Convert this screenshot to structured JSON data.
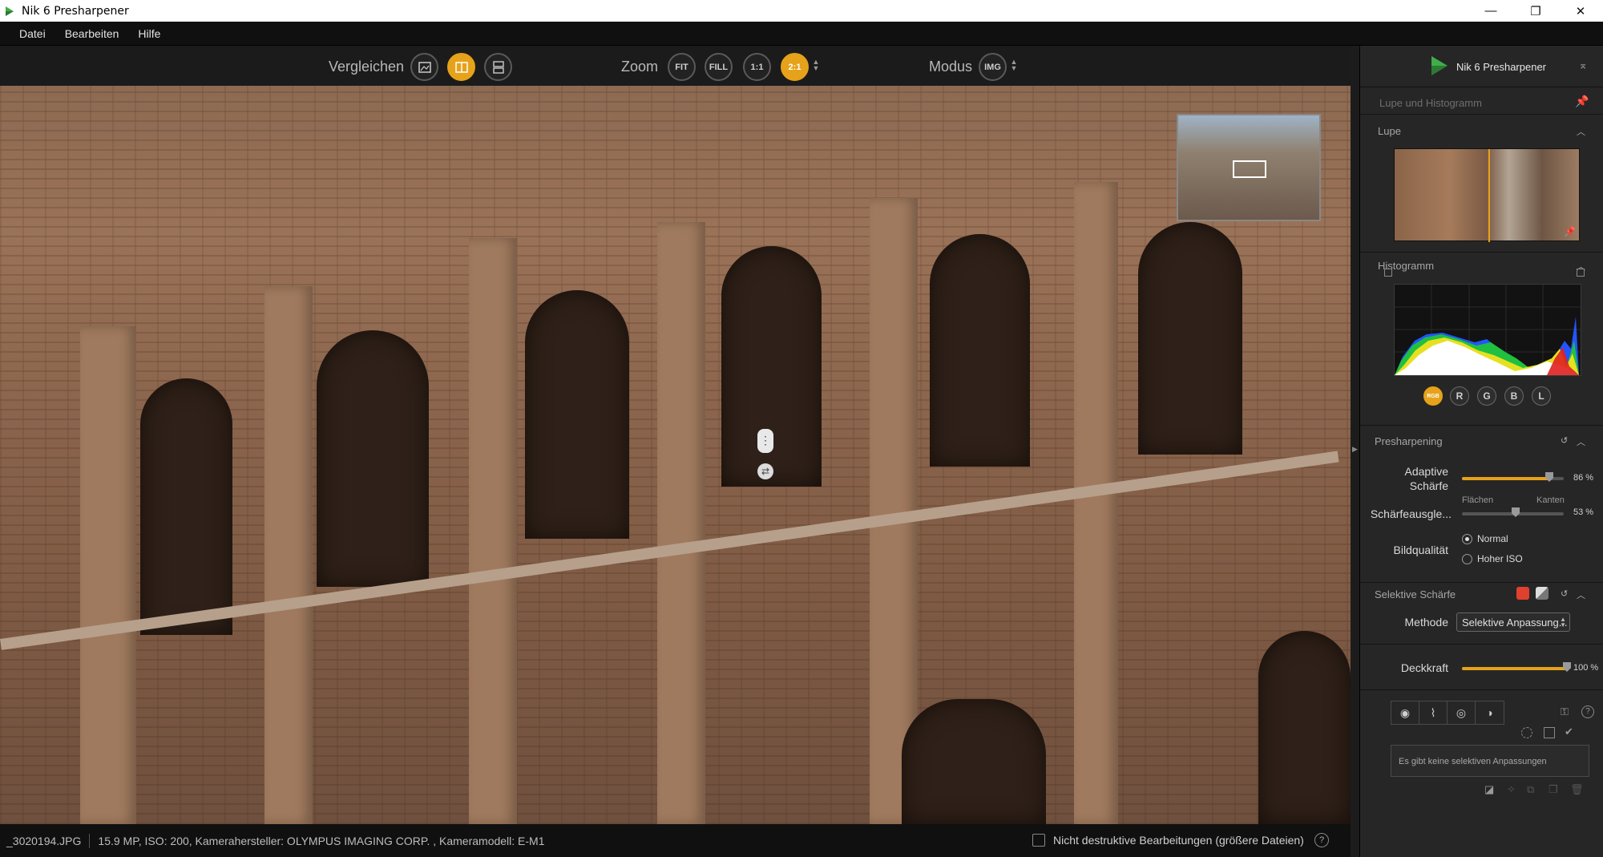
{
  "window": {
    "title": "Nik 6 Presharpener",
    "min": "—",
    "max": "❐",
    "close": "✕"
  },
  "menu": [
    "Datei",
    "Bearbeiten",
    "Hilfe"
  ],
  "toolbar": {
    "compare_label": "Vergleichen",
    "zoom_label": "Zoom",
    "zoom_fit": "FIT",
    "zoom_fill": "FILL",
    "zoom_1_1": "1:1",
    "zoom_2_1": "2:1",
    "mode_label": "Modus",
    "mode_img": "IMG"
  },
  "status": {
    "filename": "_3020194.JPG",
    "info": "15.9 MP, ISO: 200, Kamerahersteller: OLYMPUS IMAGING CORP.  , Kameramodell: E-M1",
    "nondestructive": "Nicht destruktive Bearbeitungen (größere Dateien)",
    "help": "?"
  },
  "panel": {
    "product": "Nik 6 Presharpener",
    "loupe_histogram": "Lupe und Histogramm",
    "loupe": "Lupe",
    "histogram": "Histogramm",
    "hist_buttons": {
      "rgb": "RGB",
      "r": "R",
      "g": "G",
      "b": "B",
      "l": "L"
    },
    "presharpening": {
      "title": "Presharpening",
      "adaptive_label_1": "Adaptive",
      "adaptive_label_2": "Schärfe",
      "adaptive_value": "86 %",
      "adaptive_level": 0.86,
      "balance_label": "Schärfeausgle...",
      "balance_value": "53 %",
      "balance_level": 0.53,
      "balance_left": "Flächen",
      "balance_right": "Kanten",
      "quality_label": "Bildqualität",
      "quality_normal": "Normal",
      "quality_high_iso": "Hoher ISO",
      "quality_selected": "Normal"
    },
    "selective": {
      "title": "Selektive Schärfe",
      "method_label": "Methode",
      "method_value": "Selektive Anpassung...",
      "opacity_label": "Deckkraft",
      "opacity_value": "100 %",
      "opacity_level": 1.0,
      "empty_text": "Es gibt keine selektiven Anpassungen"
    }
  },
  "colors": {
    "accent": "#e6a21a",
    "background": "#1c1c1c",
    "panel": "#262626"
  }
}
